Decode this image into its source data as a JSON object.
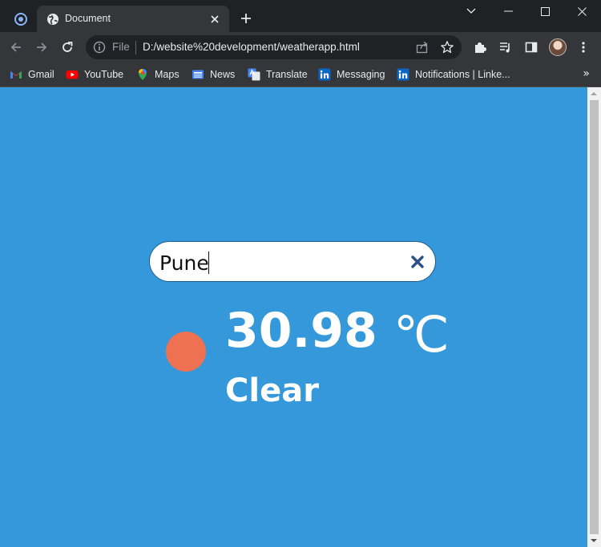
{
  "browser": {
    "tab_title": "Document",
    "address": {
      "scheme_label": "File",
      "url": "D:/website%20development/weatherapp.html"
    },
    "bookmarks": [
      {
        "label": "Gmail",
        "icon": "gmail-icon",
        "color": "#ea4335"
      },
      {
        "label": "YouTube",
        "icon": "youtube-icon",
        "color": "#ff0000"
      },
      {
        "label": "Maps",
        "icon": "maps-icon",
        "color": "#34a853"
      },
      {
        "label": "News",
        "icon": "news-icon",
        "color": "#4285f4"
      },
      {
        "label": "Translate",
        "icon": "translate-icon",
        "color": "#4285f4"
      },
      {
        "label": "Messaging",
        "icon": "linkedin-icon",
        "color": "#0a66c2"
      },
      {
        "label": "Notifications | Linke...",
        "icon": "linkedin-icon",
        "color": "#0a66c2"
      }
    ],
    "bookmarks_overflow": "»"
  },
  "app": {
    "search": {
      "value": "Pune"
    },
    "weather": {
      "temperature": "30.98",
      "unit": "℃",
      "condition": "Clear",
      "icon": "sun-icon",
      "icon_color": "#ee7152"
    },
    "background_color": "#3498db"
  }
}
